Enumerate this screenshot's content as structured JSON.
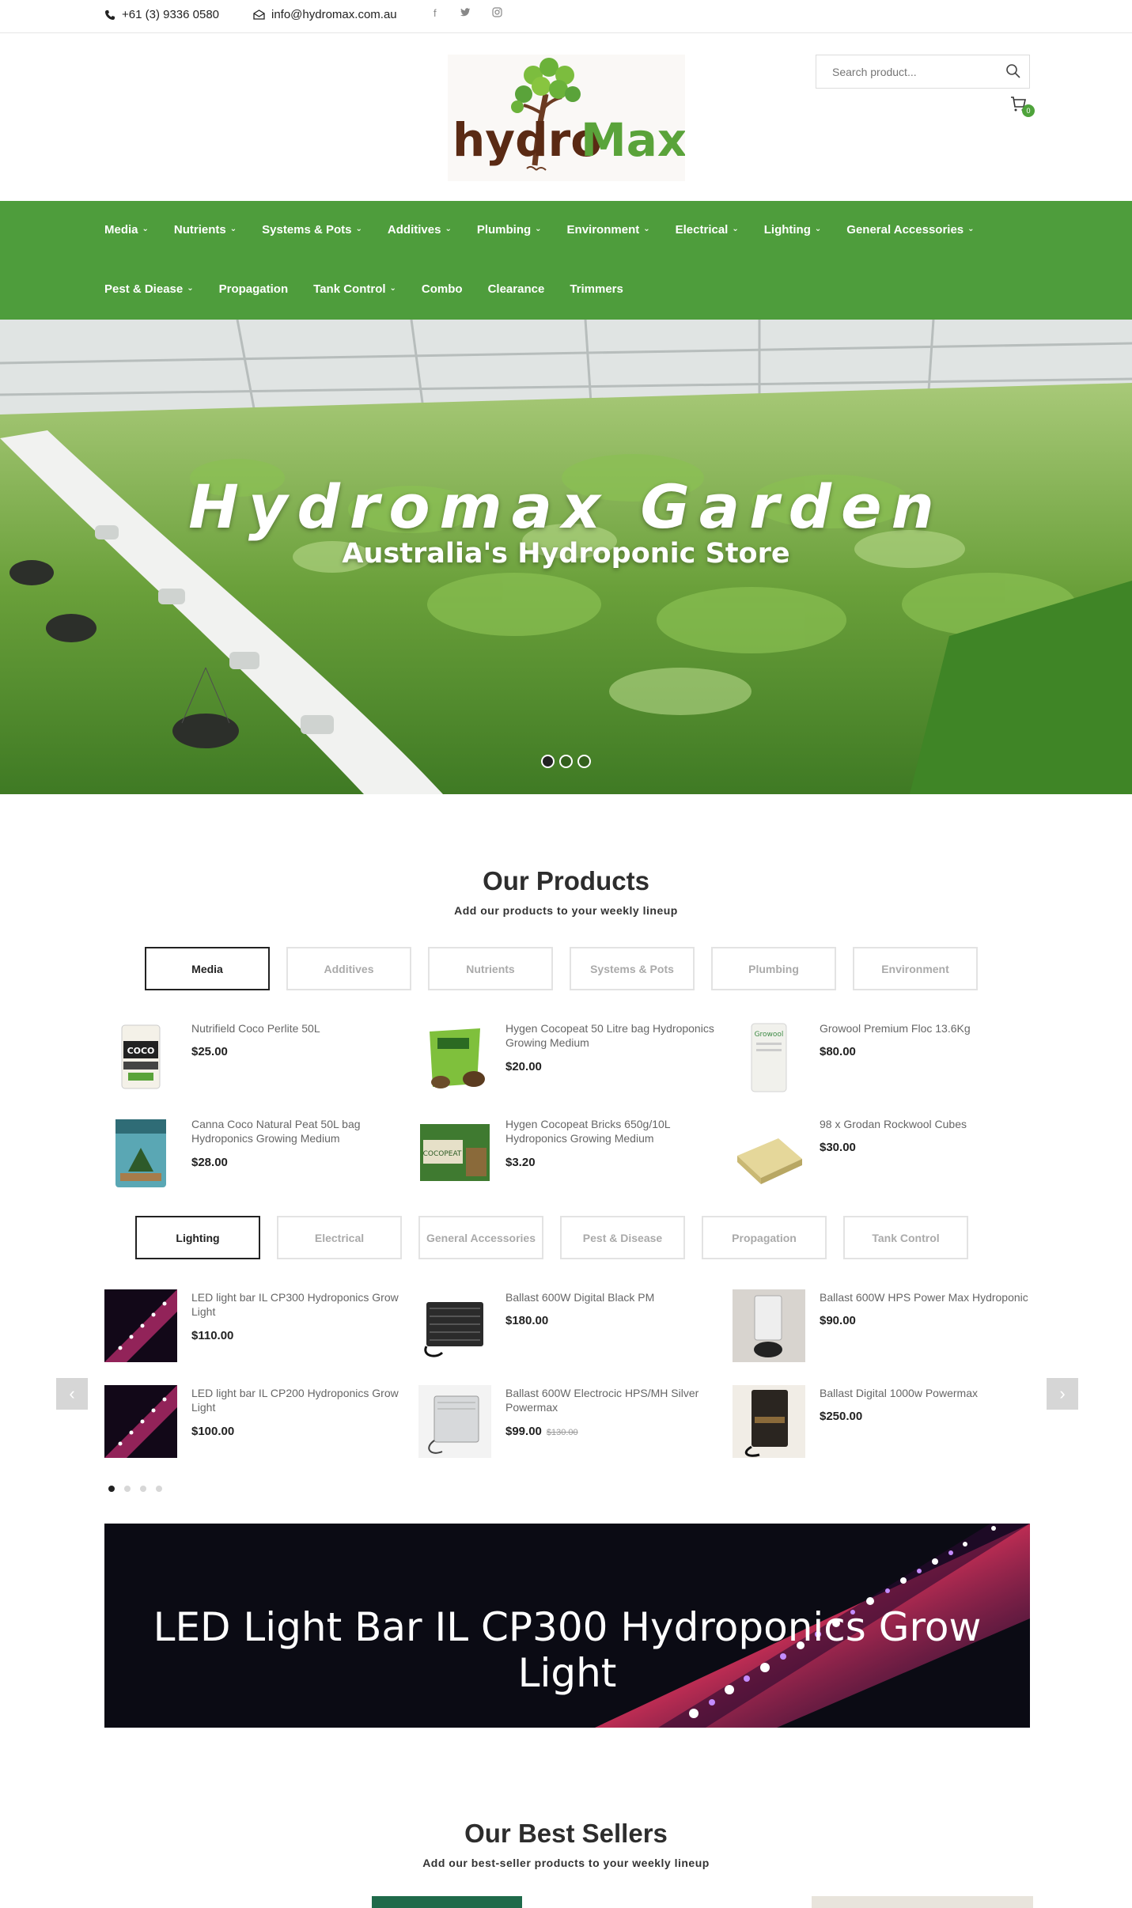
{
  "topbar": {
    "phone": "+61 (3) 9336 0580",
    "email": "info@hydromax.com.au",
    "social": [
      "facebook-icon",
      "twitter-icon",
      "instagram-icon"
    ]
  },
  "header": {
    "logo_text": "hydroMax",
    "search_placeholder": "Search product...",
    "cart_count": "0"
  },
  "nav": {
    "row1": [
      {
        "label": "Media",
        "dropdown": true
      },
      {
        "label": "Nutrients",
        "dropdown": true
      },
      {
        "label": "Systems & Pots",
        "dropdown": true
      },
      {
        "label": "Additives",
        "dropdown": true
      },
      {
        "label": "Plumbing",
        "dropdown": true
      },
      {
        "label": "Environment",
        "dropdown": true
      },
      {
        "label": "Electrical",
        "dropdown": true
      },
      {
        "label": "Lighting",
        "dropdown": true
      },
      {
        "label": "General Accessories",
        "dropdown": true
      }
    ],
    "row2": [
      {
        "label": "Pest & Diease",
        "dropdown": true
      },
      {
        "label": "Propagation",
        "dropdown": false
      },
      {
        "label": "Tank Control",
        "dropdown": true
      },
      {
        "label": "Combo",
        "dropdown": false
      },
      {
        "label": "Clearance",
        "dropdown": false
      },
      {
        "label": "Trimmers",
        "dropdown": false
      }
    ]
  },
  "hero": {
    "title": "Hydromax Garden",
    "subtitle": "Australia's Hydroponic Store",
    "slide_count": 3,
    "active_slide": 1
  },
  "products_section": {
    "title": "Our Products",
    "subtitle": "Add our products to your weekly lineup",
    "tabs1": [
      "Media",
      "Additives",
      "Nutrients",
      "Systems & Pots",
      "Plumbing",
      "Environment"
    ],
    "tabs1_active": "Media",
    "grid1": [
      {
        "name": "Nutrifield Coco Perlite 50L",
        "price": "$25.00"
      },
      {
        "name": "Hygen Cocopeat 50 Litre bag Hydroponics Growing Medium",
        "price": "$20.00"
      },
      {
        "name": "Growool Premium Floc 13.6Kg",
        "price": "$80.00"
      },
      {
        "name": "Canna Coco Natural Peat 50L bag Hydroponics Growing Medium",
        "price": "$28.00"
      },
      {
        "name": "Hygen Cocopeat Bricks 650g/10L Hydroponics Growing Medium",
        "price": "$3.20"
      },
      {
        "name": "98 x Grodan Rockwool Cubes",
        "price": "$30.00"
      }
    ],
    "tabs2": [
      "Lighting",
      "Electrical",
      "General Accessories",
      "Pest & Disease",
      "Propagation",
      "Tank Control"
    ],
    "tabs2_active": "Lighting",
    "grid2": [
      {
        "name": "LED light bar IL CP300 Hydroponics Grow Light",
        "price": "$110.00"
      },
      {
        "name": "Ballast 600W Digital Black PM",
        "price": "$180.00"
      },
      {
        "name": "Ballast 600W HPS Power Max Hydroponic",
        "price": "$90.00"
      },
      {
        "name": "LED light bar IL CP200 Hydroponics Grow Light",
        "price": "$100.00"
      },
      {
        "name": "Ballast 600W Electrocic HPS/MH Silver Powermax",
        "price": "$99.00",
        "old_price": "$130.00"
      },
      {
        "name": "Ballast Digital 1000w Powermax",
        "price": "$250.00"
      }
    ],
    "pager_count": 4,
    "pager_active": 1,
    "prev_label": "‹",
    "next_label": "›"
  },
  "banner": {
    "text": "LED Light Bar IL CP300 Hydroponics Grow Light"
  },
  "best_sellers": {
    "title": "Our Best Sellers",
    "subtitle": "Add our best-seller products to your weekly lineup"
  }
}
